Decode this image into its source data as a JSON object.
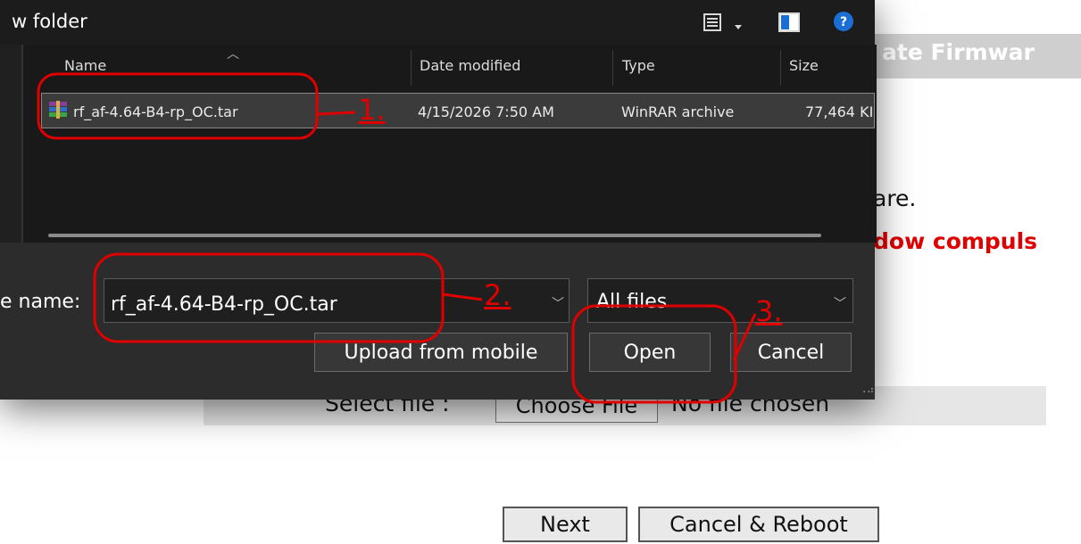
{
  "dialog": {
    "title": "w folder",
    "columns": {
      "name": "Name",
      "date": "Date modified",
      "type": "Type",
      "size": "Size"
    },
    "file": {
      "name": "rf_af-4.64-B4-rp_OC.tar",
      "date": "4/15/2026 7:50 AM",
      "type": "WinRAR archive",
      "size": "77,464 KI"
    },
    "filename_label": "e name:",
    "filename_value": "rf_af-4.64-B4-rp_OC.tar",
    "filetype": "All files",
    "buttons": {
      "upload": "Upload from mobile",
      "open": "Open",
      "cancel": "Cancel"
    }
  },
  "background": {
    "header_title": "ate Firmwar",
    "text_line1": "are.",
    "text_line2": "dow compuls",
    "select_label": "Select file :",
    "choose_file": "Choose File",
    "no_file": "No file chosen",
    "next": "Next",
    "cancel_reboot": "Cancel & Reboot"
  },
  "annotations": {
    "step1": "1.",
    "step2": "2.",
    "step3": "3."
  },
  "colors": {
    "annotation": "#e00000",
    "dialog_bg": "#202020",
    "selection": "#3b3b3b"
  }
}
